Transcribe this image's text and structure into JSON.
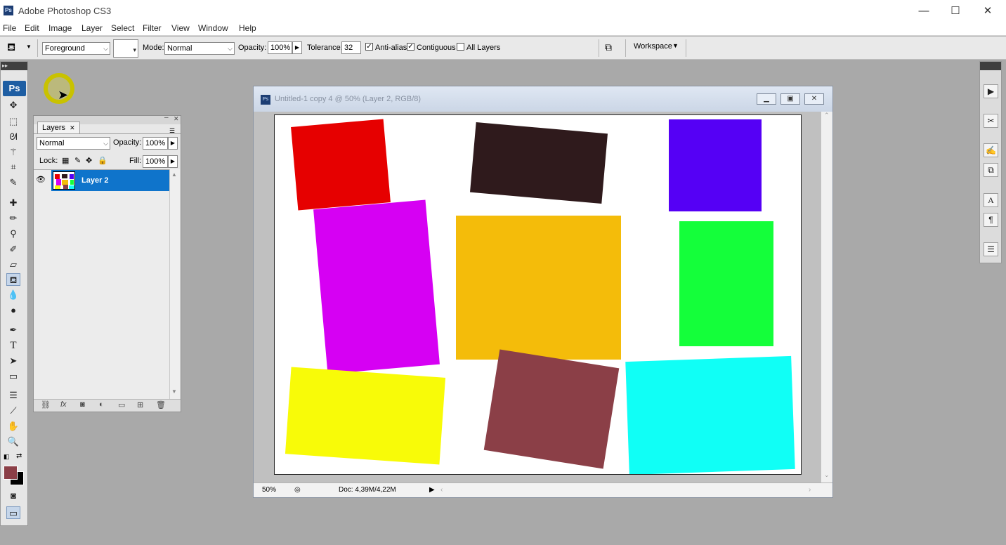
{
  "app": {
    "title": "Adobe Photoshop CS3",
    "ps_badge": "Ps"
  },
  "window_controls": {
    "minimize": "—",
    "maximize": "☐",
    "close": "✕"
  },
  "menu": [
    "File",
    "Edit",
    "Image",
    "Layer",
    "Select",
    "Filter",
    "View",
    "Window",
    "Help"
  ],
  "options": {
    "fill_source": "Foreground",
    "mode_label": "Mode:",
    "mode_value": "Normal",
    "opacity_label": "Opacity:",
    "opacity_value": "100%",
    "tolerance_label": "Tolerance:",
    "tolerance_value": "32",
    "antialias_label": "Anti-alias",
    "antialias_checked": true,
    "contiguous_label": "Contiguous",
    "contiguous_checked": true,
    "alllayers_label": "All Layers",
    "alllayers_checked": false,
    "workspace_label": "Workspace"
  },
  "tools": {
    "ps_logo": "Ps"
  },
  "layers_panel": {
    "tab_label": "Layers",
    "blend_mode": "Normal",
    "opacity_label": "Opacity:",
    "opacity_value": "100%",
    "lock_label": "Lock:",
    "fill_label": "Fill:",
    "fill_value": "100%",
    "layers": [
      {
        "name": "Layer 2",
        "visible": true,
        "selected": true
      }
    ]
  },
  "document": {
    "title": "Untitled-1 copy 4 @ 50% (Layer 2, RGB/8)",
    "zoom": "50%",
    "doc_info": "Doc: 4,39M/4,22M",
    "shapes": [
      {
        "name": "red",
        "color": "#e60000"
      },
      {
        "name": "dark-brown",
        "color": "#2f1a1c"
      },
      {
        "name": "violet",
        "color": "#5500f5"
      },
      {
        "name": "magenta",
        "color": "#d600f3"
      },
      {
        "name": "amber",
        "color": "#f4bc0a"
      },
      {
        "name": "green",
        "color": "#14ff3a"
      },
      {
        "name": "yellow",
        "color": "#f8fb08"
      },
      {
        "name": "maroon",
        "color": "#8b3f47"
      },
      {
        "name": "cyan",
        "color": "#10fff6"
      }
    ]
  },
  "colors": {
    "foreground": "#8b3f47",
    "background": "#000000",
    "layer_selected": "#0f74cb"
  }
}
